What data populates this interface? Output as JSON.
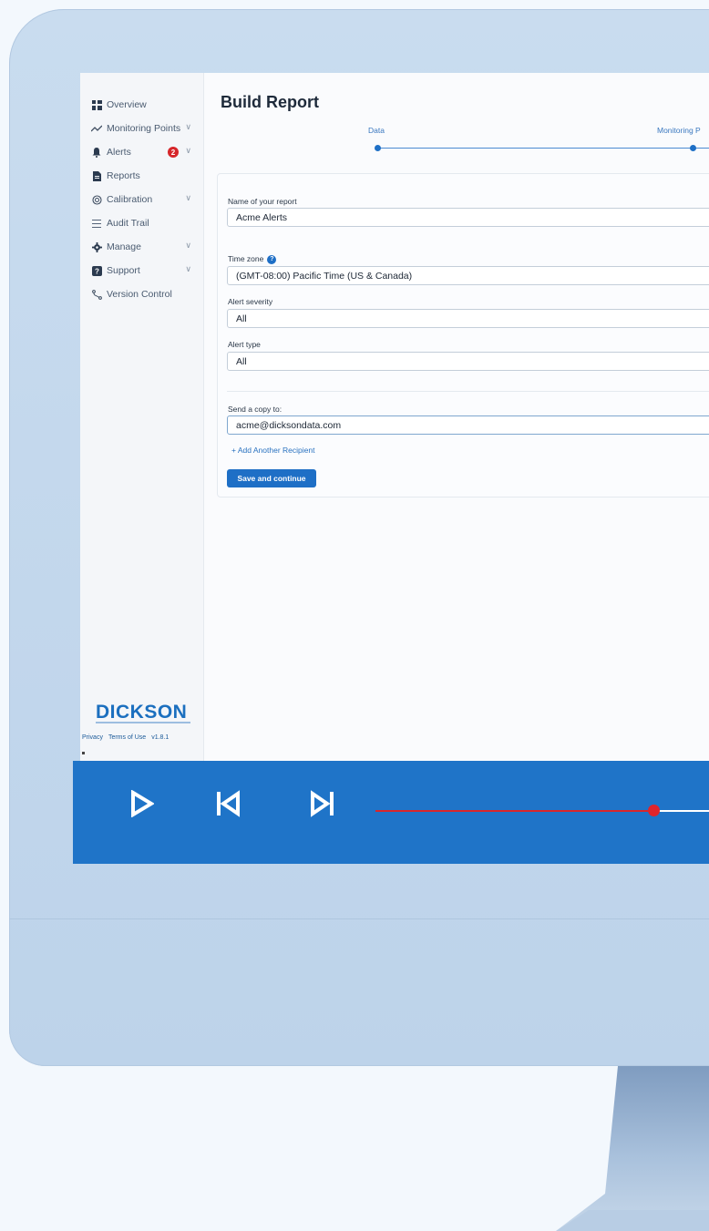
{
  "sidebar": {
    "items": [
      {
        "label": "Overview",
        "icon": "dashboard-icon"
      },
      {
        "label": "Monitoring Points",
        "icon": "trend-line-icon"
      },
      {
        "label": "Alerts",
        "icon": "bell-icon",
        "badge": "2"
      },
      {
        "label": "Reports",
        "icon": "document-icon"
      },
      {
        "label": "Calibration",
        "icon": "gauge-icon"
      },
      {
        "label": "Audit Trail",
        "icon": "list-icon"
      },
      {
        "label": "Manage",
        "icon": "gear-icon"
      },
      {
        "label": "Support",
        "icon": "help-icon"
      },
      {
        "label": "Version Control",
        "icon": "branch-icon"
      }
    ],
    "logo": "DICKSON",
    "footer": {
      "privacy": "Privacy",
      "terms": "Terms of Use",
      "version": "v1.8.1"
    }
  },
  "main": {
    "title": "Build Report",
    "steps": [
      "Data",
      "Monitoring P"
    ],
    "form": {
      "name_label": "Name of your report",
      "name_value": "Acme Alerts",
      "timezone_label": "Time zone",
      "timezone_value": "(GMT-08:00) Pacific Time (US & Canada)",
      "severity_label": "Alert severity",
      "severity_value": "All",
      "type_label": "Alert type",
      "type_value": "All",
      "copy_label": "Send a copy to:",
      "copy_value": "acme@dicksondata.com",
      "add_recipient": "+ Add Another Recipient",
      "save_label": "Save and continue"
    }
  },
  "player": {
    "progress": 0.81,
    "colors": {
      "bar": "#1f74c8",
      "progress": "#d9262c"
    }
  },
  "colors": {
    "accent": "#1e6fc6",
    "badge": "#d6262a"
  }
}
